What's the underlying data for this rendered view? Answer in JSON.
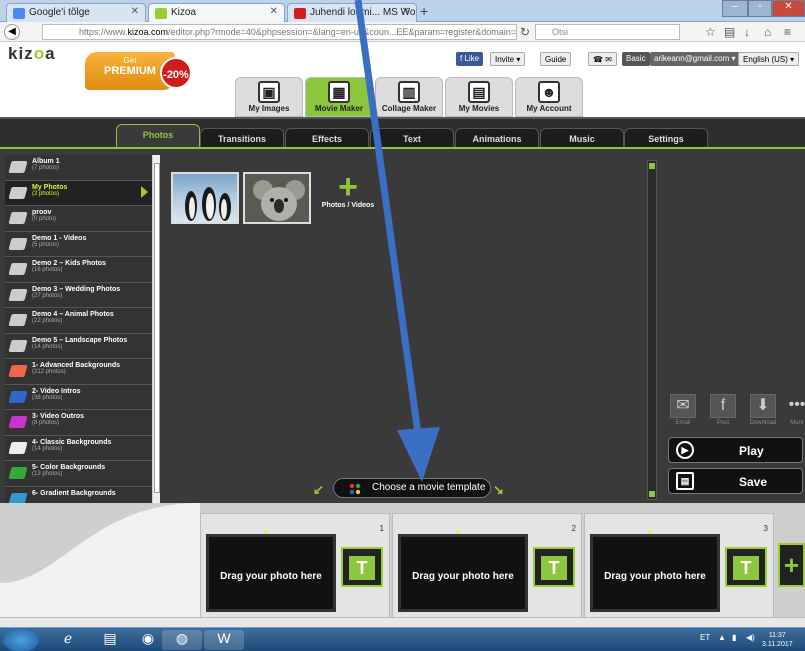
{
  "browser": {
    "tabs": [
      {
        "label": "Google'i tõlge",
        "active": false
      },
      {
        "label": "Kizoa",
        "active": true
      },
      {
        "label": "Juhendi loomi... MS Wor...",
        "active": false
      }
    ],
    "url_prefix": "https://www.",
    "url_domain": "kizoa.com",
    "url_rest": "/editor.php?rmode=40&phpsession=&lang=en-us&coun...EE&param=register&domain=www.kiz",
    "search_placeholder": "Otsi"
  },
  "header": {
    "logo_main": "kiz",
    "logo_accent": "o",
    "logo_end": "a",
    "premium_get": "Get",
    "premium_label": "PREMIUM",
    "discount": "-20%",
    "like": "Like",
    "invite": "Invite",
    "guide": "Guide",
    "basic": "Basic",
    "email": "arikeann@gmail.com",
    "language": "English (US)",
    "nav": [
      {
        "label": "My Images",
        "active": false
      },
      {
        "label": "Movie Maker",
        "active": true
      },
      {
        "label": "Collage Maker",
        "active": false
      },
      {
        "label": "My Movies",
        "active": false
      },
      {
        "label": "My Account",
        "active": false
      }
    ]
  },
  "editor_tabs": [
    "Photos",
    "Transitions",
    "Effects",
    "Text",
    "Animations",
    "Music",
    "Settings"
  ],
  "albums": [
    {
      "name": "Album 1",
      "count": "(7 photos)"
    },
    {
      "name": "My Photos",
      "count": "(2 photos)",
      "selected": true
    },
    {
      "name": "proov",
      "count": "(0 photo)"
    },
    {
      "name": "Demo 1 - Videos",
      "count": "(5 photos)"
    },
    {
      "name": "Demo 2 – Kids Photos",
      "count": "(16 photos)"
    },
    {
      "name": "Demo 3 – Wedding Photos",
      "count": "(27 photos)"
    },
    {
      "name": "Demo 4 – Animal Photos",
      "count": "(22 photos)"
    },
    {
      "name": "Demo 5 – Landscape Photos",
      "count": "(14 photos)"
    },
    {
      "name": "1- Advanced Backgrounds",
      "count": "(212 photos)"
    },
    {
      "name": "2- Video Intros",
      "count": "(38 photos)"
    },
    {
      "name": "3- Video Outros",
      "count": "(8 photos)"
    },
    {
      "name": "4- Classic Backgrounds",
      "count": "(14 photos)"
    },
    {
      "name": "5- Color Backgrounds",
      "count": "(13 photos)"
    },
    {
      "name": "6- Gradient Backgrounds",
      "count": ""
    }
  ],
  "photo_area": {
    "add_label": "Photos / Videos",
    "template_button": "Choose a movie template"
  },
  "right_panel": {
    "share": [
      "Email",
      "Post",
      "Download",
      "More"
    ],
    "play": "Play",
    "save": "Save"
  },
  "timeline": {
    "slots": [
      {
        "num": "1",
        "text": "Drag your photo here"
      },
      {
        "num": "2",
        "text": "Drag your photo here"
      },
      {
        "num": "3",
        "text": "Drag your photo here"
      }
    ],
    "t_label": "T"
  },
  "taskbar": {
    "lang": "ET",
    "time": "11:37",
    "date": "3.11.2017"
  },
  "colors": {
    "accent": "#8cc63f",
    "premium": "#e08a10",
    "discount": "#d01c1c"
  }
}
